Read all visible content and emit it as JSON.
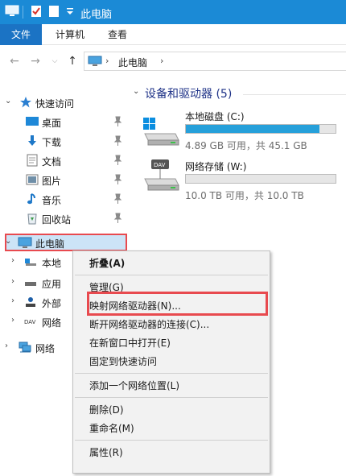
{
  "window": {
    "title": "此电脑"
  },
  "ribbon": {
    "tabs": [
      {
        "label": "文件"
      },
      {
        "label": "计算机"
      },
      {
        "label": "查看"
      }
    ]
  },
  "address": {
    "path": "此电脑"
  },
  "nav": {
    "quick_access": "快速访问",
    "items": [
      {
        "label": "桌面"
      },
      {
        "label": "下载"
      },
      {
        "label": "文档"
      },
      {
        "label": "图片"
      },
      {
        "label": "音乐"
      },
      {
        "label": "回收站"
      }
    ],
    "this_pc": "此电脑",
    "pc_children": [
      {
        "label": "本地"
      },
      {
        "label": "应用"
      },
      {
        "label": "外部"
      },
      {
        "label": "网络"
      }
    ],
    "network": "网络"
  },
  "main": {
    "group_title": "设备和驱动器 (5)",
    "drives": [
      {
        "name": "本地磁盘 (C:)",
        "info": "4.89 GB 可用，共 45.1 GB",
        "used_fraction": 0.89,
        "bar_color": "#26a0da"
      },
      {
        "name": "网络存储 (W:)",
        "info": "10.0 TB 可用，共 10.0 TB",
        "used_fraction": 0.0,
        "bar_color": "#26a0da"
      }
    ]
  },
  "context_menu": {
    "items": [
      {
        "label": "折叠(A)"
      },
      {
        "label": "管理(G)"
      },
      {
        "label": "映射网络驱动器(N)..."
      },
      {
        "label": "断开网络驱动器的连接(C)..."
      },
      {
        "label": "在新窗口中打开(E)"
      },
      {
        "label": "固定到快速访问"
      },
      {
        "label": "添加一个网络位置(L)"
      },
      {
        "label": "删除(D)"
      },
      {
        "label": "重命名(M)"
      },
      {
        "label": "属性(R)"
      }
    ]
  },
  "colors": {
    "titlebar": "#1b8ad6",
    "file_tab": "#1b73c4",
    "highlight_border": "#e84a4f",
    "selection": "#cce4f7"
  }
}
